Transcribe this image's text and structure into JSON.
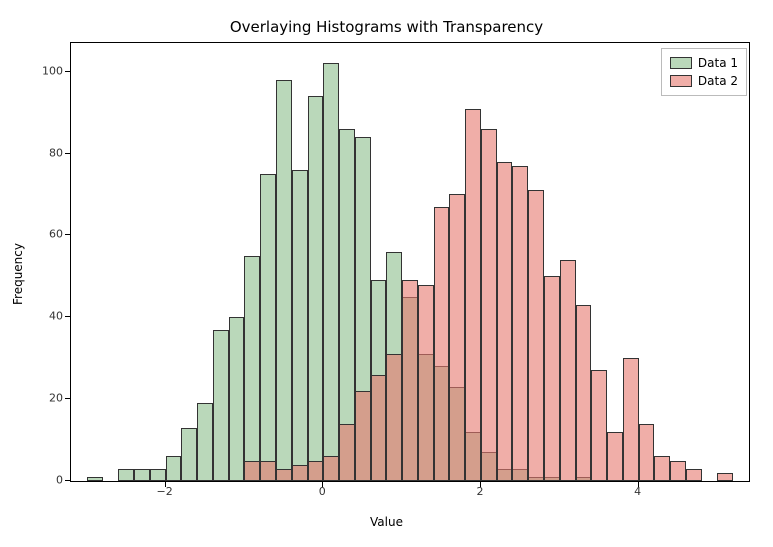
{
  "chart_data": {
    "type": "bar",
    "title": "Overlaying Histograms with Transparency",
    "xlabel": "Value",
    "ylabel": "Frequency",
    "xlim": [
      -3.2,
      5.4
    ],
    "ylim": [
      0,
      107
    ],
    "xticks": [
      -2,
      0,
      2,
      4
    ],
    "yticks": [
      0,
      20,
      40,
      60,
      80,
      100
    ],
    "bins_d1": {
      "start": -3.0,
      "width": 0.2,
      "values": [
        1,
        0,
        3,
        3,
        3,
        6,
        13,
        19,
        37,
        40,
        55,
        75,
        98,
        76,
        94,
        102,
        86,
        84,
        49,
        56,
        45,
        31,
        28,
        23,
        12,
        7,
        3,
        3,
        1,
        1,
        0,
        1
      ]
    },
    "bins_d2": {
      "start": -1.0,
      "width": 0.2,
      "values": [
        5,
        5,
        3,
        4,
        5,
        6,
        14,
        22,
        26,
        31,
        49,
        48,
        67,
        70,
        91,
        86,
        78,
        77,
        71,
        50,
        54,
        43,
        27,
        12,
        30,
        14,
        6,
        5,
        3,
        0,
        2
      ]
    },
    "series": [
      {
        "name": "Data 1",
        "color": "rgba(140,190,140,0.6)"
      },
      {
        "name": "Data 2",
        "color": "rgba(230,120,110,0.6)"
      }
    ],
    "legend_position": "upper right"
  }
}
